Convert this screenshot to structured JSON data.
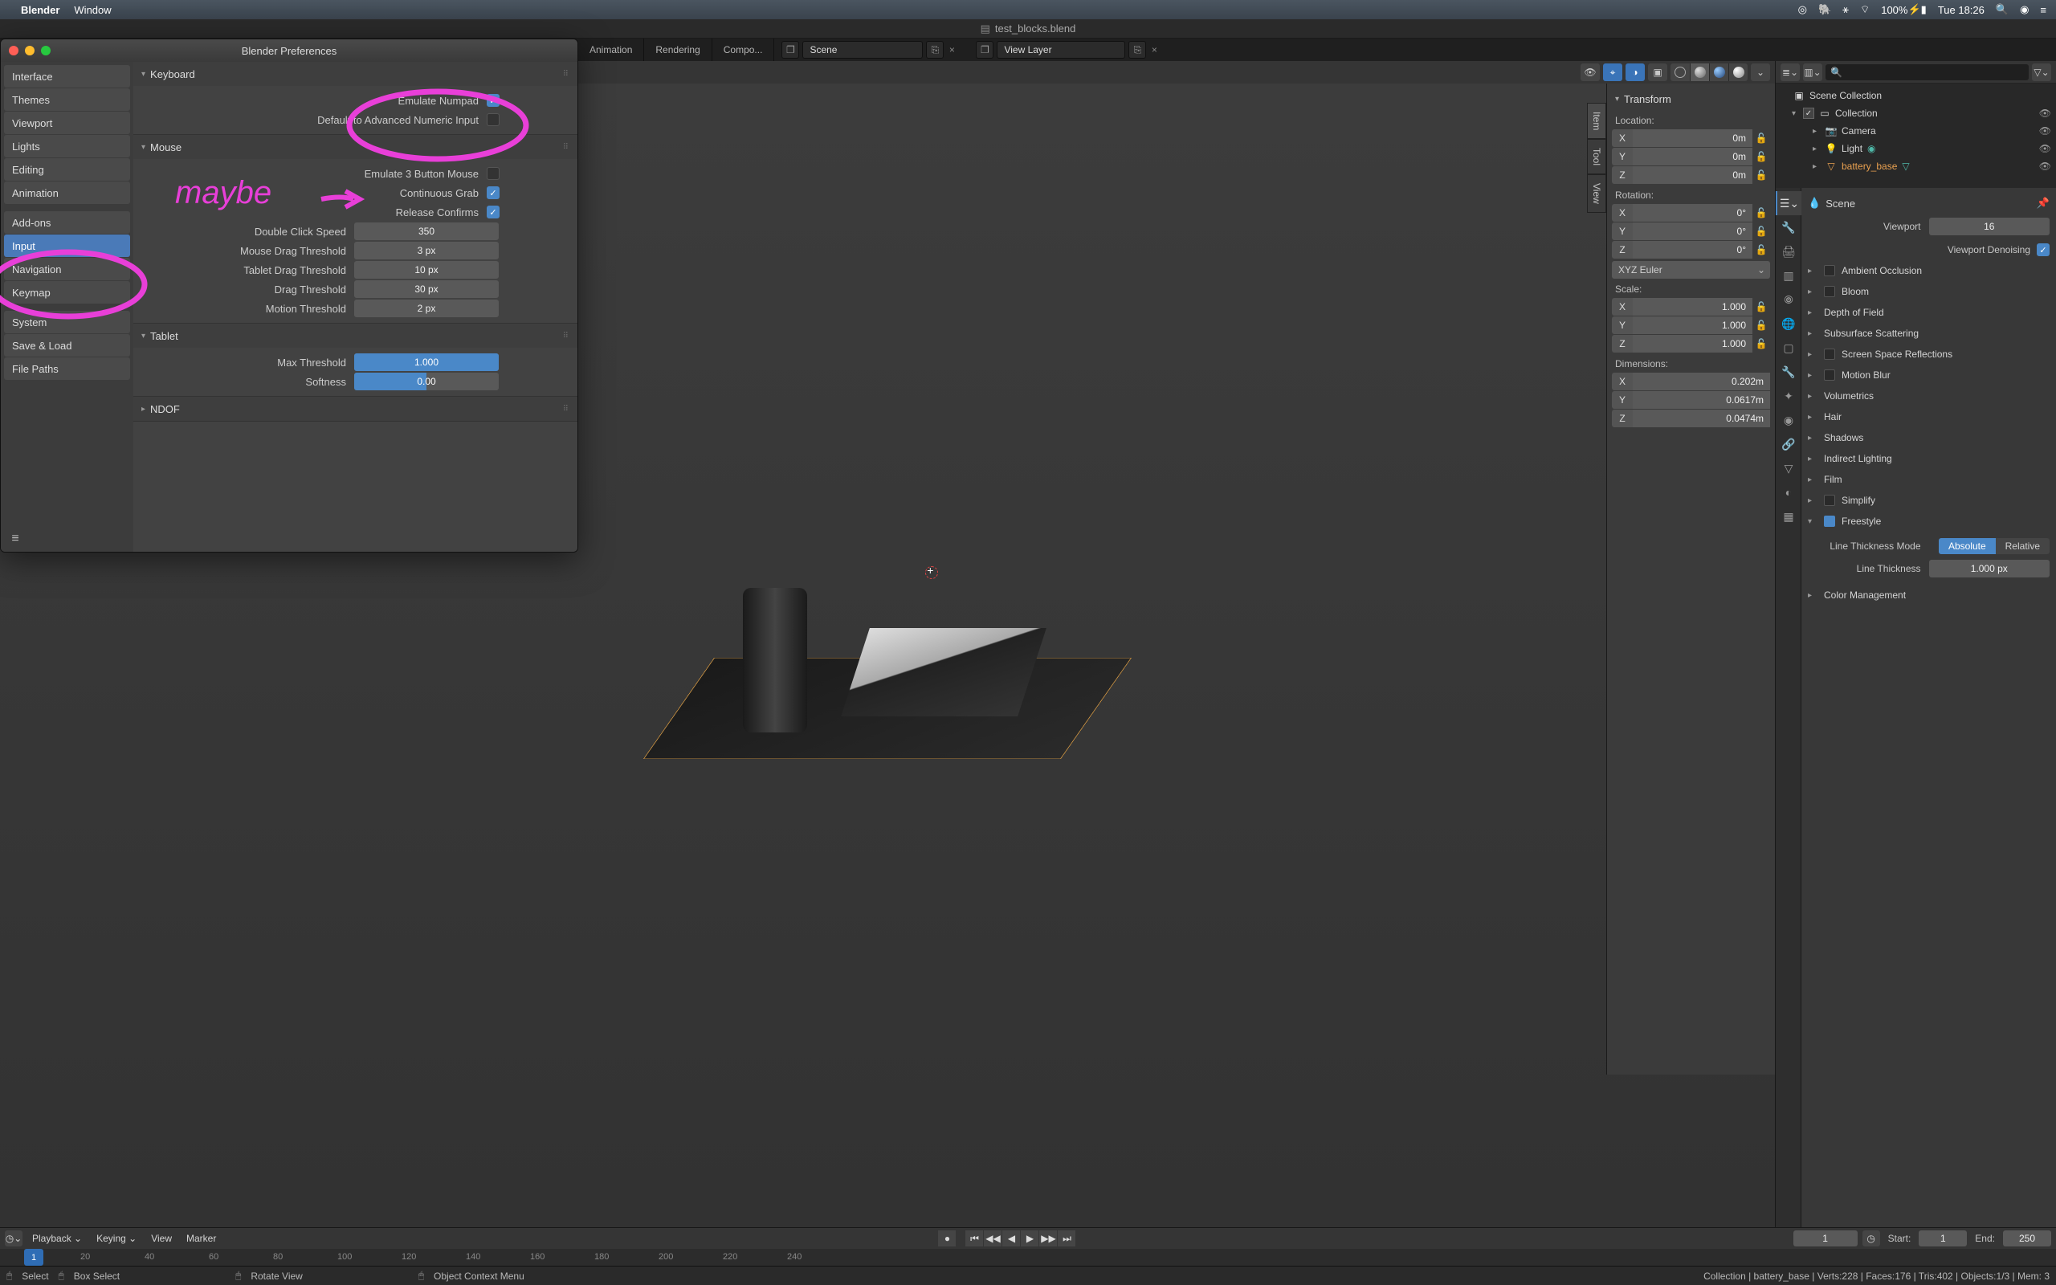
{
  "menubar": {
    "app": "Blender",
    "window": "Window",
    "battery": "100%",
    "clock": "Tue 18:26"
  },
  "titlebar": {
    "filename": "test_blocks.blend"
  },
  "workspace": {
    "tabs": [
      "Animation",
      "Rendering",
      "Compo..."
    ],
    "scene_label": "Scene",
    "viewlayer_label": "View Layer"
  },
  "npanel": {
    "title": "Transform",
    "location_label": "Location:",
    "loc": {
      "x": "0m",
      "y": "0m",
      "z": "0m"
    },
    "rotation_label": "Rotation:",
    "rot": {
      "x": "0°",
      "y": "0°",
      "z": "0°"
    },
    "euler": "XYZ Euler",
    "scale_label": "Scale:",
    "scale": {
      "x": "1.000",
      "y": "1.000",
      "z": "1.000"
    },
    "dim_label": "Dimensions:",
    "dim": {
      "x": "0.202m",
      "y": "0.0617m",
      "z": "0.0474m"
    }
  },
  "side_tabs": [
    "Item",
    "Tool",
    "View"
  ],
  "outliner": {
    "root": "Scene Collection",
    "collection": "Collection",
    "items": [
      "Camera",
      "Light",
      "battery_base"
    ]
  },
  "props": {
    "crumb": "Scene",
    "viewport_label": "Viewport",
    "viewport_value": "16",
    "denoise_label": "Viewport Denoising",
    "panels": [
      "Ambient Occlusion",
      "Bloom",
      "Depth of Field",
      "Subsurface Scattering",
      "Screen Space Reflections",
      "Motion Blur",
      "Volumetrics",
      "Hair",
      "Shadows",
      "Indirect Lighting",
      "Film",
      "Simplify",
      "Freestyle"
    ],
    "thickmode_label": "Line Thickness Mode",
    "thickmode_abs": "Absolute",
    "thickmode_rel": "Relative",
    "thickness_label": "Line Thickness",
    "thickness_value": "1.000 px",
    "color_mgmt": "Color Management"
  },
  "prefs": {
    "title": "Blender Preferences",
    "sidebar": [
      "Interface",
      "Themes",
      "Viewport",
      "Lights",
      "Editing",
      "Animation"
    ],
    "sidebar2": [
      "Add-ons",
      "Input",
      "Navigation",
      "Keymap"
    ],
    "sidebar3": [
      "System",
      "Save & Load",
      "File Paths"
    ],
    "sections": {
      "keyboard": {
        "title": "Keyboard",
        "emulate_numpad": "Emulate Numpad",
        "adv_numeric": "Default to Advanced Numeric Input"
      },
      "mouse": {
        "title": "Mouse",
        "emulate_3btn": "Emulate 3 Button Mouse",
        "cont_grab": "Continuous Grab",
        "release_confirm": "Release Confirms",
        "dbl_click": "Double Click Speed",
        "dbl_click_v": "350",
        "mousedrag": "Mouse Drag Threshold",
        "mousedrag_v": "3 px",
        "tabletdrag": "Tablet Drag Threshold",
        "tabletdrag_v": "10 px",
        "dragthresh": "Drag Threshold",
        "dragthresh_v": "30 px",
        "motion": "Motion Threshold",
        "motion_v": "2 px"
      },
      "tablet": {
        "title": "Tablet",
        "maxthresh": "Max Threshold",
        "maxthresh_v": "1.000",
        "softness": "Softness",
        "softness_v": "0.00"
      },
      "ndof": {
        "title": "NDOF"
      }
    }
  },
  "annotations": {
    "maybe": "maybe"
  },
  "timeline": {
    "playback": "Playback",
    "keying": "Keying",
    "view": "View",
    "marker": "Marker",
    "current": "1",
    "start_lbl": "Start:",
    "start": "1",
    "end_lbl": "End:",
    "end": "250",
    "playhead": "1",
    "ticks": [
      "20",
      "40",
      "60",
      "80",
      "100",
      "120",
      "140",
      "160",
      "180",
      "200",
      "220",
      "240"
    ]
  },
  "statusbar": {
    "select": "Select",
    "boxselect": "Box Select",
    "rotate": "Rotate View",
    "ctxmenu": "Object Context Menu",
    "info": "Collection | battery_base | Verts:228 | Faces:176 | Tris:402 | Objects:1/3 | Mem: 3"
  }
}
